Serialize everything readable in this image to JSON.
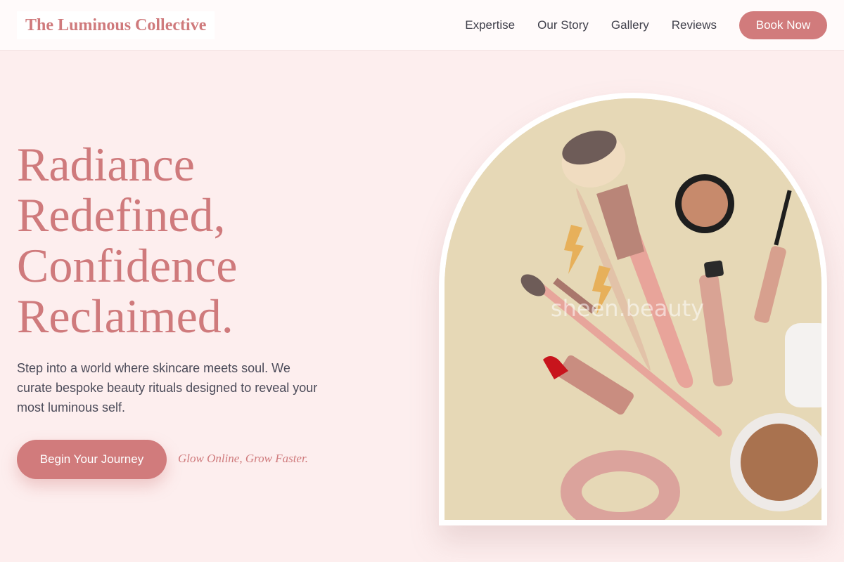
{
  "brand": {
    "name": "The Luminous Collective"
  },
  "nav": {
    "links": [
      "Expertise",
      "Our Story",
      "Gallery",
      "Reviews"
    ],
    "cta_label": "Book Now"
  },
  "hero": {
    "headline_lines": [
      "Radiance",
      "Redefined,",
      "Confidence",
      "Reclaimed."
    ],
    "description": "Step into a world where skincare meets soul. We curate bespoke beauty rituals designed to reveal your most luminous self.",
    "cta_label": "Begin Your Journey",
    "tagline": "Glow Online, Grow Faster.",
    "image_watermark": "sheen.beauty"
  },
  "colors": {
    "accent": "#cf7a7c",
    "background": "#fdeeee",
    "image_backdrop": "#e6d8b6"
  }
}
